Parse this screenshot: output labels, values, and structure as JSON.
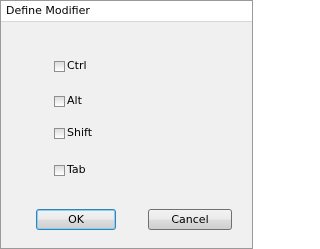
{
  "window": {
    "title": "Define Modifier"
  },
  "modifiers": [
    {
      "label": "Ctrl",
      "checked": false
    },
    {
      "label": "Alt",
      "checked": false
    },
    {
      "label": "Shift",
      "checked": false
    },
    {
      "label": "Tab",
      "checked": false
    }
  ],
  "buttons": {
    "ok_label": "OK",
    "cancel_label": "Cancel"
  },
  "colors": {
    "dialog_background": "#f0f0f0",
    "title_background": "#ffffff",
    "default_button_border": "#3c7fb1"
  }
}
